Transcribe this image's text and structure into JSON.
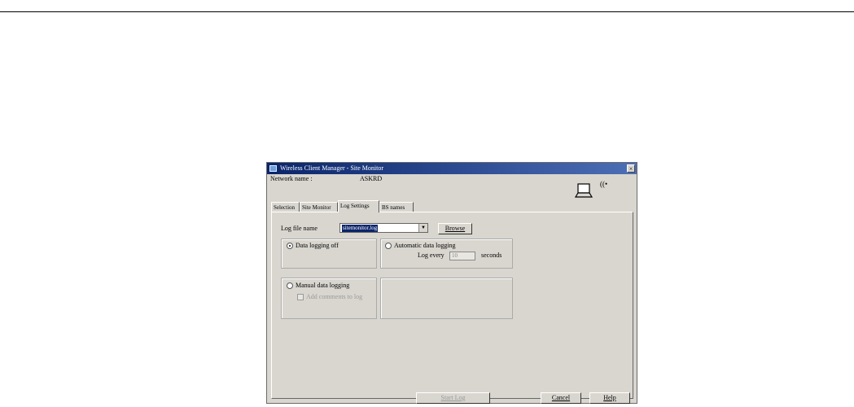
{
  "window": {
    "title": "Wireless Client Manager - Site Monitor",
    "close_glyph": "×"
  },
  "header": {
    "network_label": "Network name :",
    "network_value": "ASKRD",
    "wifi_glyph": "((•"
  },
  "tabs": [
    {
      "label": "Selection",
      "active": false
    },
    {
      "label": "Site Monitor",
      "active": false
    },
    {
      "label": "Log Settings",
      "active": true
    },
    {
      "label": "BS names",
      "active": false
    }
  ],
  "log_settings": {
    "log_file_label": "Log file name",
    "log_file_value": "sitemonitor.log",
    "dropdown_glyph": "▼",
    "browse_label": "Browse",
    "data_logging_off_label": "Data logging off",
    "data_logging_off_selected": true,
    "automatic_logging_label": "Automatic data logging",
    "automatic_logging_selected": false,
    "log_every_label": "Log every",
    "log_every_value": "10",
    "seconds_label": "seconds",
    "manual_logging_label": "Manual data logging",
    "manual_logging_selected": false,
    "add_comments_label": "Add comments to log"
  },
  "footer": {
    "start_log_label": "Start Log",
    "cancel_label": "Cancel",
    "help_label": "Help"
  }
}
